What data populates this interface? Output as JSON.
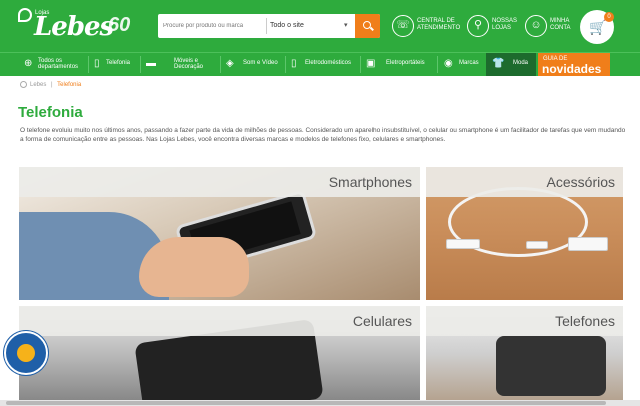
{
  "header": {
    "logo_small": "Lojas",
    "logo_name": "Lebes",
    "logo_sixty": "60",
    "search_placeholder": "Procure por produto ou marca",
    "search_scope": "Todo o site",
    "links": [
      {
        "label": "CENTRAL DE\nATENDIMENTO",
        "icon": "headset-icon"
      },
      {
        "label": "NOSSAS\nLOJAS",
        "icon": "location-pin-icon"
      },
      {
        "label": "MINHA\nCONTA",
        "icon": "user-icon"
      }
    ],
    "cart_count": "0"
  },
  "nav": {
    "items": [
      {
        "label": "Todos os\ndepartamentos",
        "icon": "plus-circle-icon"
      },
      {
        "label": "Telefonia",
        "icon": "phone-icon"
      },
      {
        "label": "Móveis e\nDecoração",
        "icon": "sofa-icon"
      },
      {
        "label": "Som e Vídeo",
        "icon": "speaker-icon"
      },
      {
        "label": "Eletrodomésticos",
        "icon": "fridge-icon"
      },
      {
        "label": "Eletroportáteis",
        "icon": "blender-icon"
      },
      {
        "label": "Marcas",
        "icon": "tag-icon"
      },
      {
        "label": "Moda",
        "icon": "shirt-icon"
      }
    ],
    "guia_top": "GUIA DE",
    "guia_bottom": "novidades"
  },
  "breadcrumb": {
    "home": "Lebes",
    "current": "Telefonia"
  },
  "page": {
    "title": "Telefonia",
    "description": "O telefone evoluiu muito nos últimos anos, passando a fazer parte da vida de milhões de pessoas. Considerado um aparelho insubstituível, o celular ou smartphone é um facilitador de tarefas que vem mudando a forma de comunicação entre as pessoas. Nas Lojas Lebes, você encontra diversas marcas e modelos de telefones fixo, celulares e smartphones."
  },
  "categories": [
    {
      "label": "Smartphones"
    },
    {
      "label": "Acessórios"
    },
    {
      "label": "Celulares"
    },
    {
      "label": "Telefones"
    }
  ],
  "colors": {
    "brand_green": "#2eab3d",
    "accent_orange": "#f07e1a"
  }
}
